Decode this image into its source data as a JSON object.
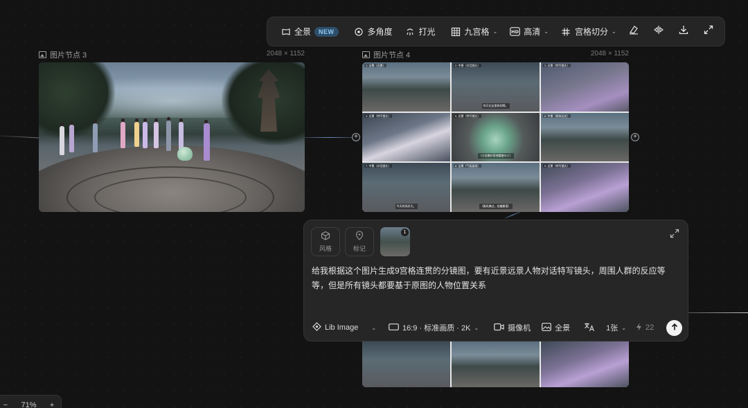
{
  "toolbar": {
    "panorama_label": "全景",
    "new_badge": "NEW",
    "multi_angle_label": "多角度",
    "lighting_label": "打光",
    "nine_grid_label": "九宫格",
    "hd_label": "高清",
    "grid_split_label": "宫格切分"
  },
  "node3": {
    "title": "图片节点 3",
    "size": "2048 × 1152"
  },
  "node4": {
    "title": "图片节点 4",
    "size": "2048 × 1152",
    "captions": [
      "1. 全景（近景）",
      "2. 中景（对话镜头）",
      "3. 近景（特写镜头）",
      "4. 近景（特写镜头）",
      "5. 近景（特写镜头）",
      "6. 中景（群体反应）",
      "7. 中景（对话镜头）",
      "8. 全景（气氛展现）",
      "9. 近景（特写镜头）"
    ],
    "subtitles": [
      "",
      "你又在这里练剑啊。",
      "",
      "",
      "（小龙兽好奇地看着众人）",
      "",
      "今天的风好大。",
      "（微风拂过，花瓣飘落）",
      ""
    ]
  },
  "panel": {
    "style_chip": "风格",
    "mark_chip": "标记",
    "thumb_count": "1",
    "prompt": "给我根据这个图片生成9宫格连贯的分镜图，要有近景远景人物对话特写镜头，周围人群的反应等等，但是所有镜头都要基于原图的人物位置关系",
    "model_label": "Lib Image",
    "ratio_label": "16:9 · 标准画质 · 2K",
    "camera_label": "摄像机",
    "panorama_label": "全景",
    "count_label": "1张",
    "credits": "22"
  },
  "zoom": {
    "minus": "−",
    "value": "71%",
    "plus": "+"
  }
}
